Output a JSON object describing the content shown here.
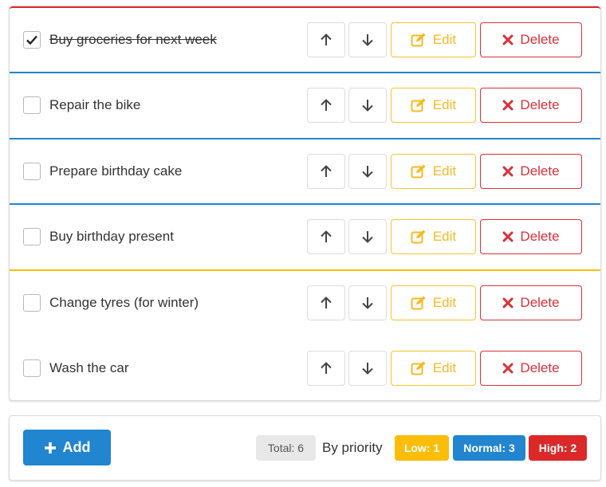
{
  "colors": {
    "high": "#db2828",
    "normal": "#2185d0",
    "low": "#fbbd08",
    "edit": "#f7b924",
    "delete": "#d9313a"
  },
  "tasks": [
    {
      "text": "Buy groceries for next week",
      "done": true,
      "priority": "high"
    },
    {
      "text": "Repair the bike",
      "done": false,
      "priority": "normal"
    },
    {
      "text": "Prepare birthday cake",
      "done": false,
      "priority": "normal"
    },
    {
      "text": "Buy birthday present",
      "done": false,
      "priority": "normal"
    },
    {
      "text": "Change tyres (for winter)",
      "done": false,
      "priority": "low"
    },
    {
      "text": "Wash the car",
      "done": false,
      "priority": "none"
    }
  ],
  "actions": {
    "edit_label": "Edit",
    "delete_label": "Delete",
    "up_icon": "arrow-up-icon",
    "down_icon": "arrow-down-icon"
  },
  "footer": {
    "add_label": "Add",
    "total_label": "Total: 6",
    "by_priority_label": "By priority",
    "low_label": "Low: 1",
    "normal_label": "Normal: 3",
    "high_label": "High: 2"
  }
}
